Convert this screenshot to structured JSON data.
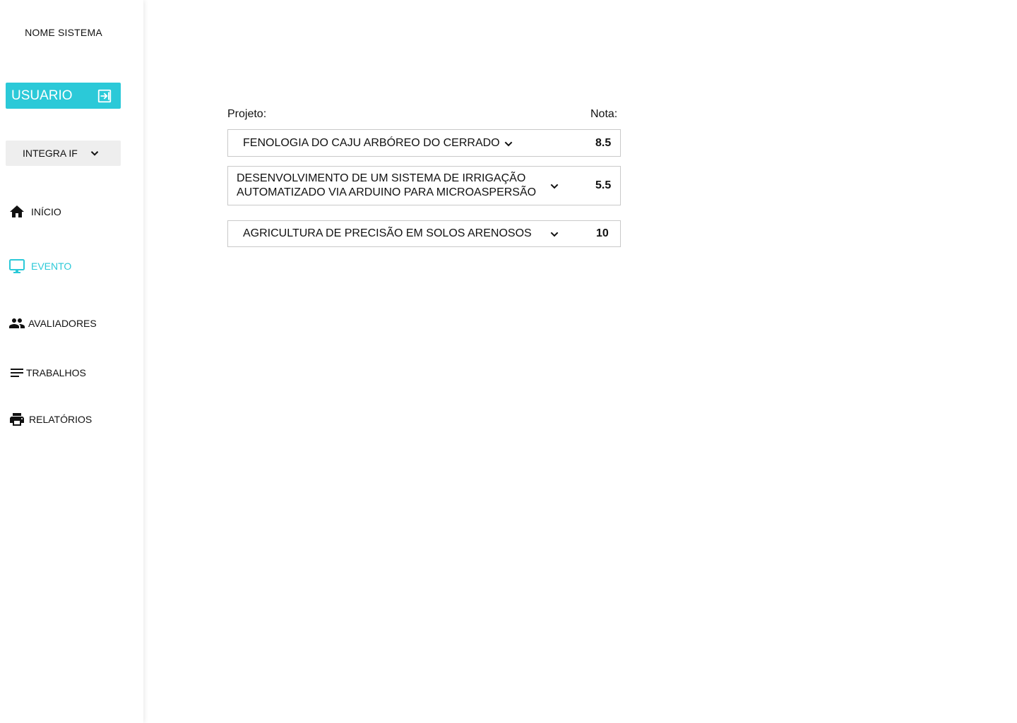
{
  "sidebar": {
    "system_name": "NOME SISTEMA",
    "user_button_label": "USUARIO",
    "user_button_icon": "logout-icon",
    "event_selector": {
      "value": "INTEGRA IF",
      "icon": "chevron-down-icon"
    },
    "nav": [
      {
        "label": "INÍCIO",
        "icon": "home-icon",
        "active": false
      },
      {
        "label": "EVENTO",
        "icon": "desktop-icon",
        "active": true
      },
      {
        "label": "AVALIADORES",
        "icon": "people-icon",
        "active": false
      },
      {
        "label": "TRABALHOS",
        "icon": "list-icon",
        "active": false
      },
      {
        "label": "RELATÓRIOS",
        "icon": "printer-icon",
        "active": false
      }
    ]
  },
  "main": {
    "header_projeto": "Projeto:",
    "header_nota": "Nota:",
    "projects": [
      {
        "title": "FENOLOGIA DO CAJU ARBÓREO DO CERRADO",
        "score": "8.5"
      },
      {
        "title": "DESENVOLVIMENTO DE UM SISTEMA DE IRRIGAÇÃO\nAUTOMATIZADO VIA ARDUINO PARA MICROASPERSÃO",
        "score": "5.5"
      },
      {
        "title": "AGRICULTURA DE PRECISÃO EM SOLOS ARENOSOS",
        "score": "10"
      }
    ]
  },
  "colors": {
    "accent": "#2bc9d8",
    "selector_bg": "#eeeeee",
    "border": "#c9c9c9"
  }
}
